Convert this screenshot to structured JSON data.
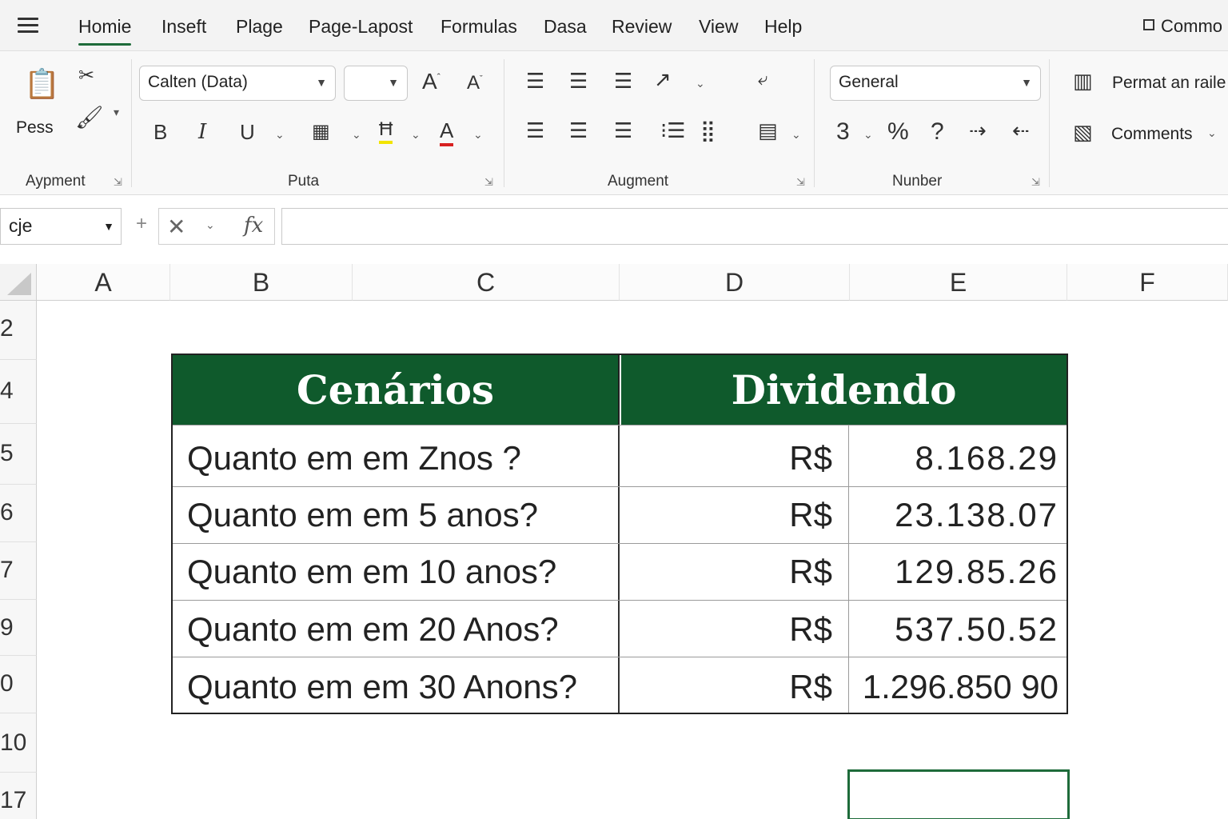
{
  "menu": {
    "items": [
      "Homie",
      "Inseft",
      "Plage",
      "Page-Lapost",
      "Formulas",
      "Dasa",
      "Review",
      "View",
      "Help"
    ],
    "active": "Homie",
    "common_label": "Commo"
  },
  "ribbon": {
    "clipboard": {
      "paste_label": "Pess",
      "group_label": "Aypment"
    },
    "font": {
      "font_name": "Calten (Data)",
      "font_size": "",
      "group_label": "Puta"
    },
    "alignment": {
      "group_label": "Augment"
    },
    "number": {
      "format": "General",
      "currency_symbol": "3",
      "group_label": "Nunber"
    },
    "styles": {
      "format_label": "Permat an raile",
      "comments_label": "Comments"
    }
  },
  "formula_bar": {
    "name_box": "cje",
    "fx_label": "fx",
    "formula": ""
  },
  "columns": [
    "A",
    "B",
    "C",
    "D",
    "E",
    "F"
  ],
  "rows": [
    "2",
    "4",
    "5",
    "6",
    "7",
    "9",
    "0",
    "10",
    "17"
  ],
  "table": {
    "headers": [
      "Cenários",
      "Dividendo"
    ],
    "rows": [
      {
        "scenario": "Quanto em em Znos ?",
        "currency": "R$",
        "value": "8.168.29"
      },
      {
        "scenario": "Quanto em em 5 anos?",
        "currency": "R$",
        "value": "23.138.07"
      },
      {
        "scenario": "Quanto em em 10 anos?",
        "currency": "R$",
        "value": "129.85.26"
      },
      {
        "scenario": "Quanto em em 20 Anos?",
        "currency": "R$",
        "value": "537.50.52"
      },
      {
        "scenario": "Quanto em em 30 Anons?",
        "currency": "R$",
        "value": "1.296.850 90"
      }
    ]
  },
  "colors": {
    "header_green": "#0f5a2c",
    "accent_green": "#1e6b3a"
  }
}
